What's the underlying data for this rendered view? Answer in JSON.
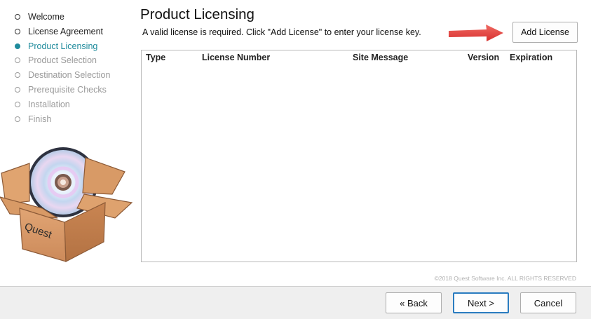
{
  "steps": [
    {
      "label": "Welcome",
      "state": "done"
    },
    {
      "label": "License Agreement",
      "state": "done"
    },
    {
      "label": "Product Licensing",
      "state": "active"
    },
    {
      "label": "Product Selection",
      "state": "pending"
    },
    {
      "label": "Destination Selection",
      "state": "pending"
    },
    {
      "label": "Prerequisite Checks",
      "state": "pending"
    },
    {
      "label": "Installation",
      "state": "pending"
    },
    {
      "label": "Finish",
      "state": "pending"
    }
  ],
  "product_box": {
    "label": "Quest"
  },
  "main": {
    "title": "Product Licensing",
    "description": "A valid license is required.  Click \"Add License\" to enter your license key.",
    "add_license_label": "Add License",
    "table": {
      "columns": [
        "Type",
        "License Number",
        "Site Message",
        "Version",
        "Expiration"
      ],
      "rows": []
    },
    "copyright": "©2018 Quest Software Inc. ALL RIGHTS RESERVED"
  },
  "footer": {
    "back_label": "« Back",
    "next_label": "Next >",
    "cancel_label": "Cancel"
  },
  "colors": {
    "active_step": "#1f8b9c",
    "pending_step": "#9a9a9a",
    "arrow": "#e8403f",
    "box": "#dda071",
    "default_button_border": "#2a7cc0"
  }
}
